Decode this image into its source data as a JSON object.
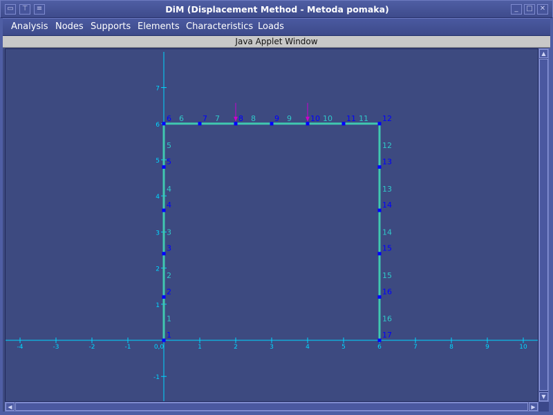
{
  "window": {
    "title": "DiM (Displacement Method - Metoda pomaka)",
    "left_buttons": [
      "system-menu-icon",
      "pin-icon",
      "shade-icon"
    ],
    "right_buttons": [
      "minimize-icon",
      "maximize-icon",
      "close-icon"
    ]
  },
  "menu": {
    "items": [
      {
        "label": "Analysis"
      },
      {
        "label": "Nodes"
      },
      {
        "label": "Supports"
      },
      {
        "label": "Elements"
      },
      {
        "label": "Characteristics"
      },
      {
        "label": "Loads"
      }
    ]
  },
  "applet": {
    "label": "Java Applet Window"
  },
  "colors": {
    "background": "#3d4a80",
    "axis": "#00d8ff",
    "frame": "#40c8b0",
    "node": "#0000ff",
    "node_label": "#0000ff",
    "element_label": "#30c8c8",
    "load": "#cc00cc"
  },
  "plot": {
    "x_ticks": [
      "-4",
      "-3",
      "-2",
      "-1",
      "0,0",
      "1",
      "2",
      "3",
      "4",
      "5",
      "6",
      "7",
      "8",
      "9",
      "10"
    ],
    "y_ticks": [
      "-1",
      "1",
      "2",
      "3",
      "4",
      "5",
      "6",
      "7"
    ],
    "nodes": [
      {
        "id": "1",
        "x": 0,
        "y": 0
      },
      {
        "id": "2",
        "x": 0,
        "y": 1.2
      },
      {
        "id": "3",
        "x": 0,
        "y": 2.4
      },
      {
        "id": "4",
        "x": 0,
        "y": 3.6
      },
      {
        "id": "5",
        "x": 0,
        "y": 4.8
      },
      {
        "id": "6",
        "x": 0,
        "y": 6
      },
      {
        "id": "7",
        "x": 1,
        "y": 6
      },
      {
        "id": "8",
        "x": 2,
        "y": 6
      },
      {
        "id": "9",
        "x": 3,
        "y": 6
      },
      {
        "id": "10",
        "x": 4,
        "y": 6
      },
      {
        "id": "11",
        "x": 5,
        "y": 6
      },
      {
        "id": "12",
        "x": 6,
        "y": 6
      },
      {
        "id": "13",
        "x": 6,
        "y": 4.8
      },
      {
        "id": "14",
        "x": 6,
        "y": 3.6
      },
      {
        "id": "15",
        "x": 6,
        "y": 2.4
      },
      {
        "id": "16",
        "x": 6,
        "y": 1.2
      },
      {
        "id": "17",
        "x": 6,
        "y": 0
      }
    ],
    "elements": [
      {
        "id": "1",
        "from": 1,
        "to": 2
      },
      {
        "id": "2",
        "from": 2,
        "to": 3
      },
      {
        "id": "3",
        "from": 3,
        "to": 4
      },
      {
        "id": "4",
        "from": 4,
        "to": 5
      },
      {
        "id": "5",
        "from": 5,
        "to": 6
      },
      {
        "id": "6",
        "from": 6,
        "to": 7
      },
      {
        "id": "7",
        "from": 7,
        "to": 8
      },
      {
        "id": "8",
        "from": 8,
        "to": 9
      },
      {
        "id": "9",
        "from": 9,
        "to": 10
      },
      {
        "id": "10",
        "from": 10,
        "to": 11
      },
      {
        "id": "11",
        "from": 11,
        "to": 12
      },
      {
        "id": "12",
        "from": 12,
        "to": 13
      },
      {
        "id": "13",
        "from": 13,
        "to": 14
      },
      {
        "id": "14",
        "from": 14,
        "to": 15
      },
      {
        "id": "15",
        "from": 15,
        "to": 16
      },
      {
        "id": "16",
        "from": 16,
        "to": 17
      }
    ],
    "loads": [
      {
        "node": 8,
        "direction": "down"
      },
      {
        "node": 10,
        "direction": "down"
      }
    ]
  }
}
